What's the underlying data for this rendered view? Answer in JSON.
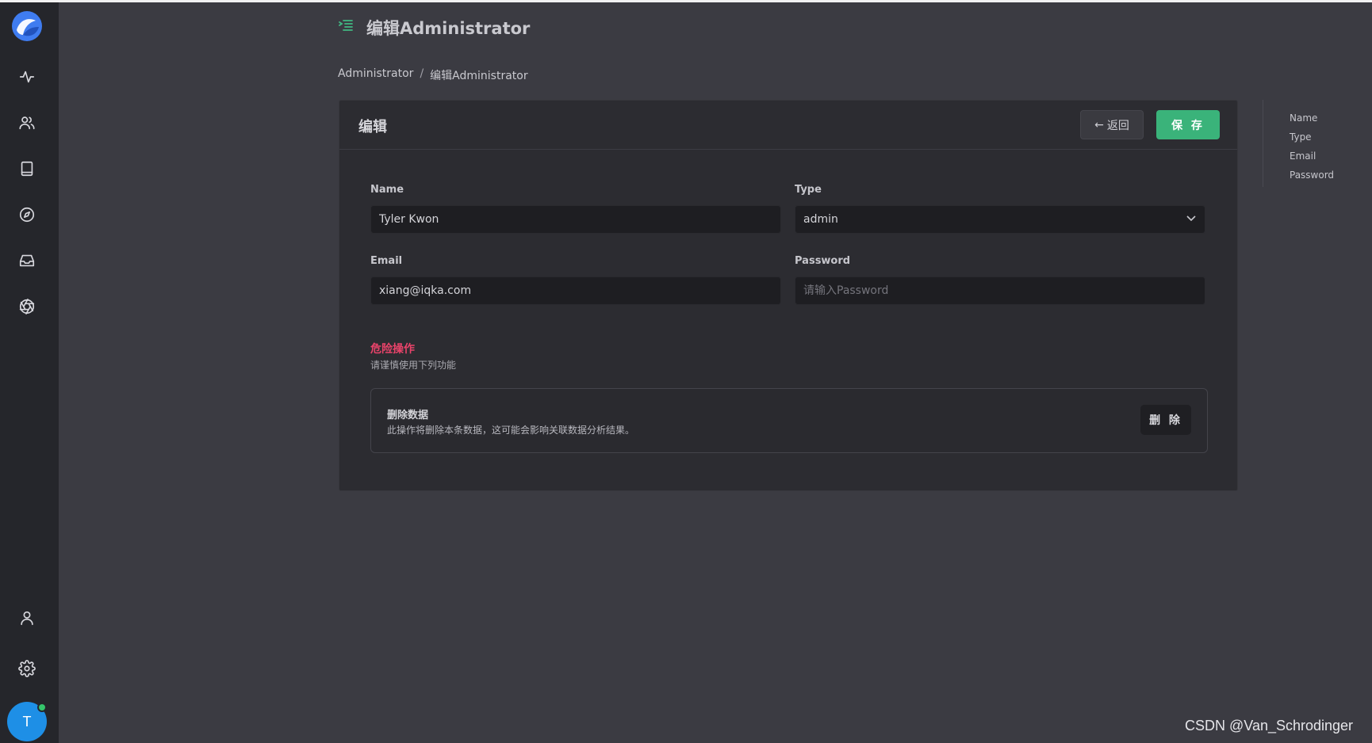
{
  "sidebar": {
    "icons": [
      "logo-icon",
      "activity-icon",
      "users-icon",
      "book-icon",
      "compass-icon",
      "inbox-icon",
      "aperture-icon",
      "user-icon",
      "gear-icon"
    ],
    "avatar_initial": "T"
  },
  "header": {
    "title": "编辑Administrator"
  },
  "breadcrumb": {
    "items": [
      "Administrator",
      "编辑Administrator"
    ],
    "separator": "/"
  },
  "card": {
    "title": "编辑",
    "back_label": "返回",
    "save_label": "保 存"
  },
  "form": {
    "name_label": "Name",
    "name_value": "Tyler Kwon",
    "type_label": "Type",
    "type_value": "admin",
    "email_label": "Email",
    "email_value": "xiang@iqka.com",
    "password_label": "Password",
    "password_placeholder": "请输入Password"
  },
  "danger": {
    "title": "危险操作",
    "subtitle": "请谨慎使用下列功能",
    "item_title": "删除数据",
    "item_desc": "此操作将删除本条数据，这可能会影响关联数据分析结果。",
    "delete_label": "删 除"
  },
  "anchor_nav": {
    "items": [
      "Name",
      "Type",
      "Email",
      "Password"
    ]
  },
  "watermark": "CSDN @Van_Schrodinger",
  "colors": {
    "accent_green": "#3ab37a",
    "danger_red": "#e9436a",
    "logo_blue": "#3f7cf0",
    "avatar_blue": "#1e8fe6"
  }
}
